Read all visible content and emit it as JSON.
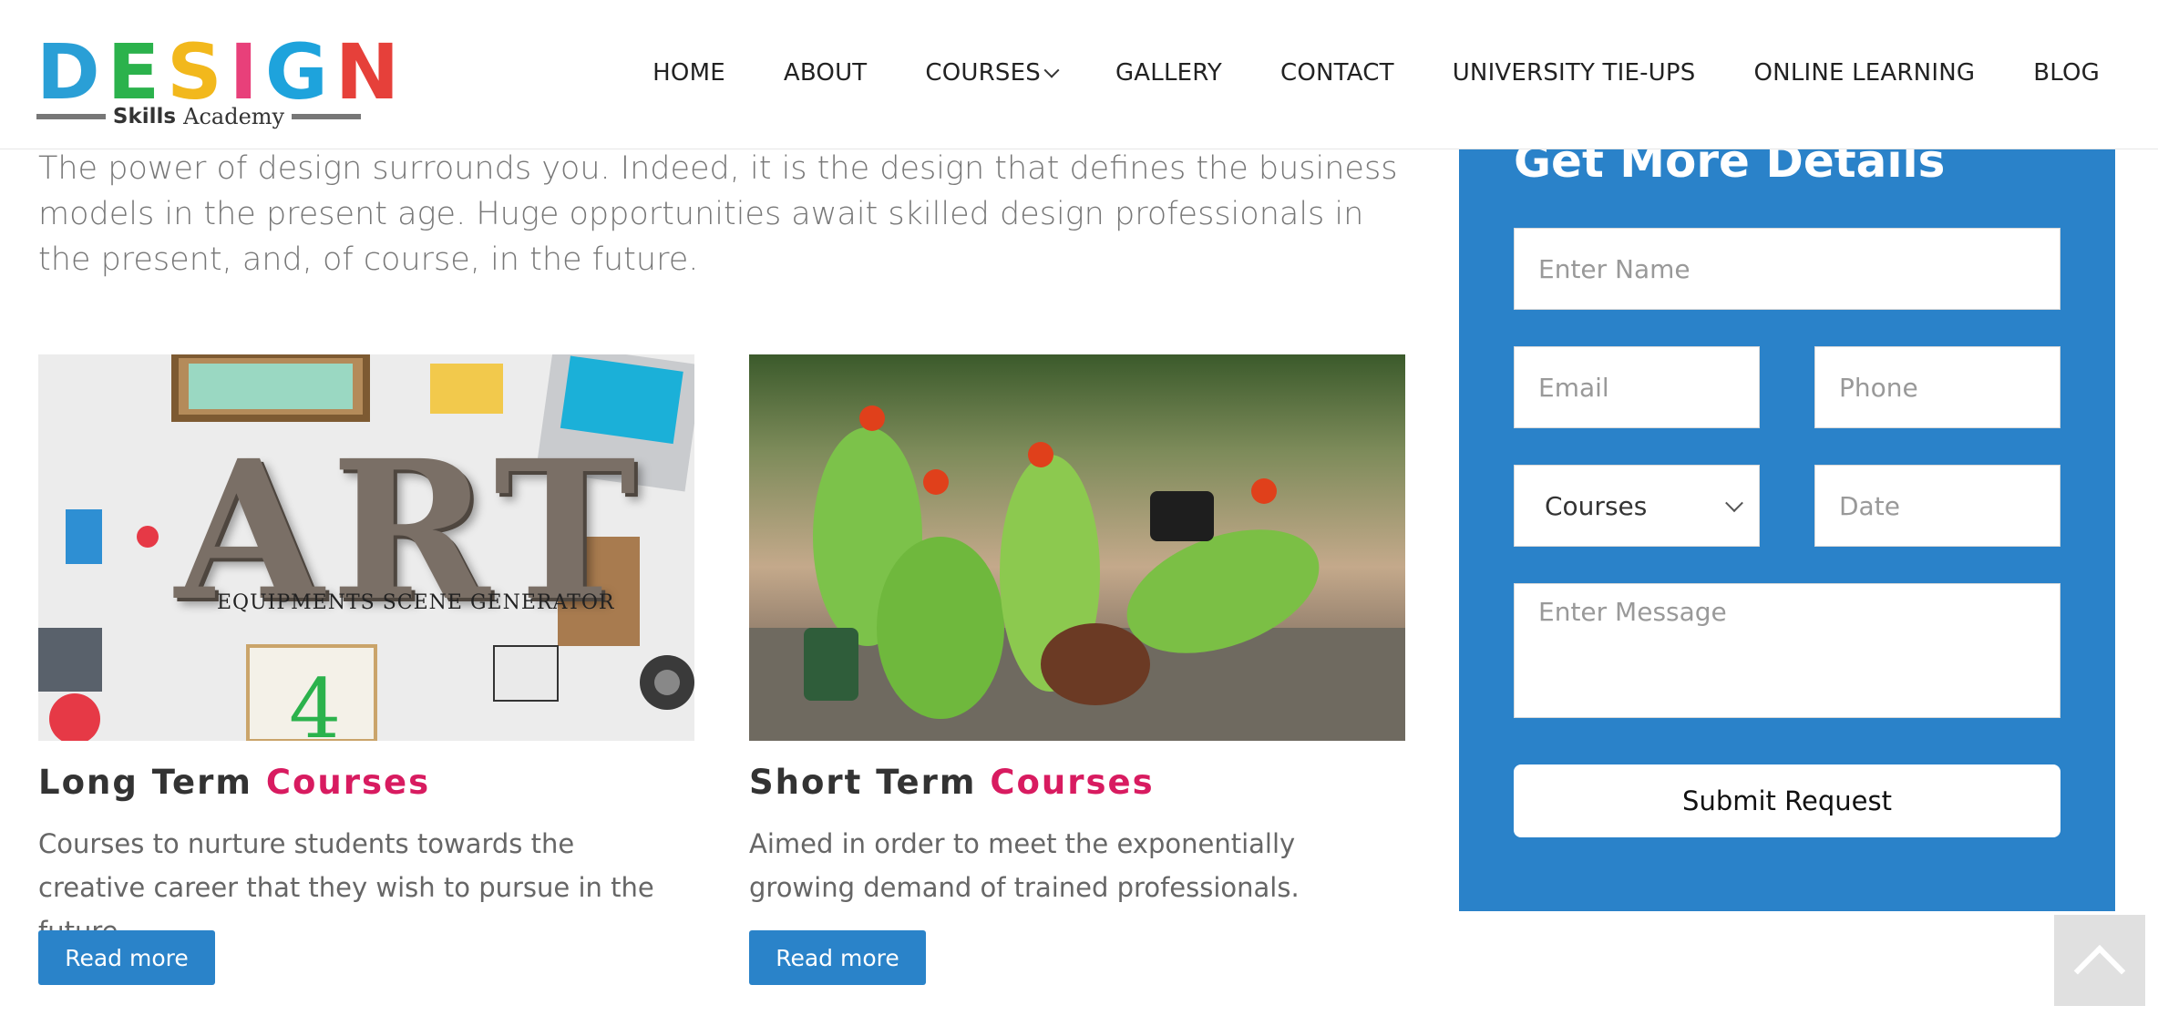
{
  "logo": {
    "letters": [
      "D",
      "E",
      "S",
      "I",
      "G",
      "N"
    ],
    "letter_colors": [
      "#2a9fd6",
      "#2bb24c",
      "#f2b81c",
      "#e8407a",
      "#1ea3dc",
      "#e6403a"
    ],
    "skills": "Skills",
    "academy": "Academy"
  },
  "nav": {
    "items": [
      {
        "label": "HOME"
      },
      {
        "label": "ABOUT"
      },
      {
        "label": "COURSES"
      },
      {
        "label": "GALLERY"
      },
      {
        "label": "CONTACT"
      },
      {
        "label": "UNIVERSITY TIE-UPS"
      },
      {
        "label": "ONLINE LEARNING"
      },
      {
        "label": "BLOG"
      }
    ]
  },
  "intro": "The power of design surrounds you. Indeed, it is the design that defines the business models in the present age. Huge opportunities await skilled design professionals in the present, and, of course, in the future.",
  "cards": [
    {
      "title_plain": "Long Term",
      "title_accent": "Courses",
      "description": "Courses to nurture students towards the creative career that they wish to pursue in the future.",
      "button": "Read more",
      "image_word": "ART",
      "image_caption": "EQUIPMENTS SCENE GENERATOR"
    },
    {
      "title_plain": "Short Term",
      "title_accent": "Courses",
      "description": "Aimed in order to meet the exponentially growing demand of trained professionals.",
      "button": "Read more"
    }
  ],
  "form": {
    "title": "Get More Details",
    "name_placeholder": "Enter Name",
    "email_placeholder": "Email",
    "phone_placeholder": "Phone",
    "courses_selected": "Courses",
    "date_placeholder": "Date",
    "message_placeholder": "Enter Message",
    "submit": "Submit Request"
  },
  "colors": {
    "primary_blue": "#2a83c9",
    "accent_pink": "#d81b60"
  },
  "icons": {
    "back_to_top": "chevron-up-icon",
    "dropdown": "chevron-down-icon"
  }
}
